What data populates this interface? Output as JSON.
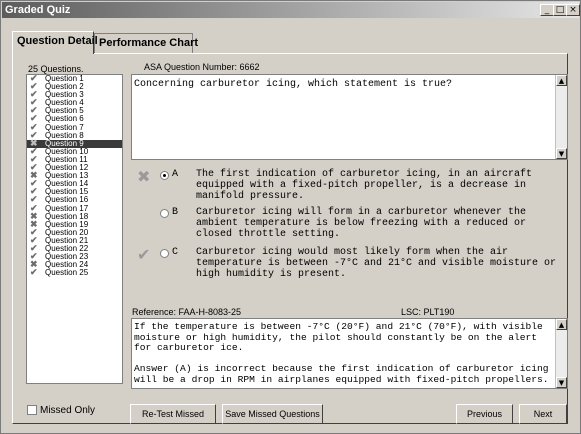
{
  "window": {
    "title": "Graded Quiz",
    "controls": [
      "_",
      "□",
      "×"
    ]
  },
  "tabs": [
    {
      "label": "Question Detail"
    },
    {
      "label": "Performance Chart"
    }
  ],
  "questions_header": "25 Questions.",
  "questions": [
    {
      "label": "Question 1",
      "status": "correct"
    },
    {
      "label": "Question 2",
      "status": "correct"
    },
    {
      "label": "Question 3",
      "status": "correct"
    },
    {
      "label": "Question 4",
      "status": "correct"
    },
    {
      "label": "Question 5",
      "status": "correct"
    },
    {
      "label": "Question 6",
      "status": "correct"
    },
    {
      "label": "Question 7",
      "status": "correct"
    },
    {
      "label": "Question 8",
      "status": "correct"
    },
    {
      "label": "Question 9",
      "status": "incorrect",
      "selected": true
    },
    {
      "label": "Question 10",
      "status": "correct"
    },
    {
      "label": "Question 11",
      "status": "correct"
    },
    {
      "label": "Question 12",
      "status": "correct"
    },
    {
      "label": "Question 13",
      "status": "incorrect"
    },
    {
      "label": "Question 14",
      "status": "correct"
    },
    {
      "label": "Question 15",
      "status": "correct"
    },
    {
      "label": "Question 16",
      "status": "correct"
    },
    {
      "label": "Question 17",
      "status": "correct"
    },
    {
      "label": "Question 18",
      "status": "incorrect"
    },
    {
      "label": "Question 19",
      "status": "incorrect"
    },
    {
      "label": "Question 20",
      "status": "correct"
    },
    {
      "label": "Question 21",
      "status": "correct"
    },
    {
      "label": "Question 22",
      "status": "correct"
    },
    {
      "label": "Question 23",
      "status": "correct"
    },
    {
      "label": "Question 24",
      "status": "incorrect"
    },
    {
      "label": "Question 25",
      "status": "correct"
    }
  ],
  "question_number": "ASA Question Number: 6662",
  "question_text": "Concerning carburetor icing, which statement is true?",
  "answers": [
    {
      "letter": "A",
      "text": "The first indication of carburetor icing, in an aircraft\nequipped with a fixed-pitch propeller, is a decrease in\nmanifold pressure.",
      "selected": true,
      "mark": "incorrect"
    },
    {
      "letter": "B",
      "text": "Carburetor icing will form in a carburetor whenever the\nambient temperature is below freezing with a reduced or\nclosed throttle setting.",
      "selected": false,
      "mark": "none"
    },
    {
      "letter": "C",
      "text": "Carburetor icing would most likely form when the air\ntemperature is between -7°C and 21°C and visible moisture or\nhigh humidity is present.",
      "selected": false,
      "mark": "correct"
    }
  ],
  "reference": "Reference:   FAA-H-8083-25",
  "lsc": "LSC: PLT190",
  "explanation": "If the temperature is between -7°C (20°F) and 21°C (70°F), with visible\nmoisture or high humidity, the pilot should constantly be on the alert\nfor carburetor ice.\n\nAnswer (A) is incorrect because the first indication of carburetor icing\nwill be a drop in RPM in airplanes equipped with fixed-pitch propellers.",
  "missed_only_label": "Missed Only",
  "buttons": {
    "retest": "Re-Test Missed",
    "save": "Save Missed Questions",
    "previous": "Previous",
    "next": "Next"
  },
  "colors": {
    "selected_row": "#3a3a3a",
    "mark": "#9a9a9a"
  }
}
